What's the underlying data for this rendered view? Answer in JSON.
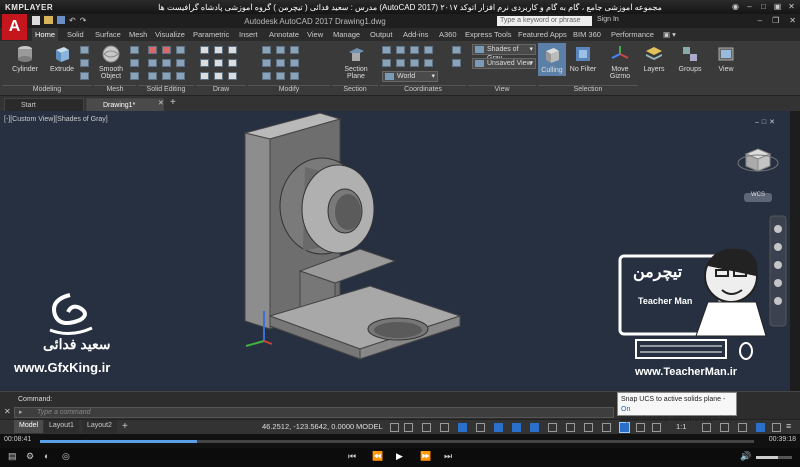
{
  "player": {
    "logo": "KMPLAYER",
    "title": "مجموعه آموزشی جامع ، گام به گام و کاربردی نرم افزار اتوکد ۲۰۱۷ (AutoCAD 2017) مدرس : سعید فدائی ( تیچرمن ) گروه آموزشی پادشاه گرافیست ها",
    "time_elapsed": "00:08:41",
    "time_total": "00:39:18",
    "progress_fraction": 0.22
  },
  "acad": {
    "logo": "A",
    "title": "Autodesk AutoCAD 2017    Drawing1.dwg",
    "search_placeholder": "Type a keyword or phrase",
    "sign_in": "Sign In"
  },
  "ribbon_tabs": [
    "Home",
    "Solid",
    "Surface",
    "Mesh",
    "Visualize",
    "Parametric",
    "Insert",
    "Annotate",
    "View",
    "Manage",
    "Output",
    "Add-ins",
    "A360",
    "Express Tools",
    "Featured Apps",
    "BIM 360",
    "Performance"
  ],
  "ribbon": {
    "cylinder": "Cylinder",
    "extrude": "Extrude",
    "smooth_object": "Smooth\nObject",
    "section_plane": "Section\nPlane",
    "culling": "Culling",
    "no_filter": "No Filter",
    "move_gizmo": "Move\nGizmo",
    "layers": "Layers",
    "groups": "Groups",
    "view": "View",
    "visual_style": "Shades of Gray",
    "saved_view": "Unsaved View",
    "ucs": "World",
    "panels": [
      "Modeling",
      "Mesh",
      "Solid Editing",
      "Draw",
      "Modify",
      "Section",
      "Coordinates",
      "View",
      "Selection"
    ]
  },
  "file_tabs": [
    "Start",
    "Drawing1*"
  ],
  "viewport": {
    "label": "[-][Custom View][Shades of Gray]",
    "viewcube_label": "WCS"
  },
  "command": {
    "label": "Command:",
    "placeholder": "Type a command"
  },
  "tooltip": {
    "line1": "Snap UCS to active solids plane - ",
    "line1_state": "On",
    "line2": "Dynamics UCS - UCSDETECT (F6)"
  },
  "status": {
    "layout_tabs": [
      "Model",
      "Layout1",
      "Layout2"
    ],
    "coords": "46.2512, -123.5642, 0.0000",
    "model": "MODEL",
    "scale": "1:1"
  },
  "overlay": {
    "gfx_name": "سعید فدائی",
    "gfx_url": "www.GfxKing.ir",
    "tm_fa": "تیچرمن",
    "tm_en": "Teacher Man",
    "tm_url": "www.TeacherMan.ir"
  },
  "colors": {
    "viewport_bg": "#273041",
    "acad_red": "#c4161c",
    "accent_blue": "#2a6fc9"
  }
}
